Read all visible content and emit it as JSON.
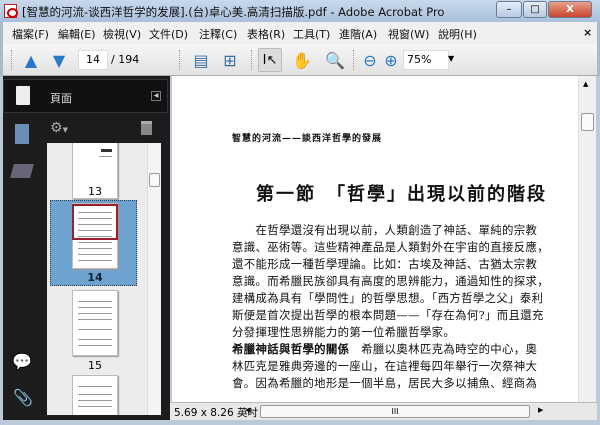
{
  "window": {
    "title": "[智慧的河流-谈西洋哲学的发展].(台)卓心美.高清扫描版.pdf - Adobe Acrobat Pro",
    "minimize": "–",
    "maximize": "□",
    "close": "X"
  },
  "menu": [
    "檔案(F)",
    "編輯(E)",
    "檢視(V)",
    "文件(D)",
    "注釋(C)",
    "表格(R)",
    "工具(T)",
    "進階(A)",
    "視窗(W)",
    "說明(H)"
  ],
  "menu_close": "×",
  "toolbar": {
    "page_current": "14",
    "page_total": "/ 194",
    "zoom": "75%"
  },
  "panel": {
    "title": "頁面",
    "thumbnails": [
      {
        "label": "13"
      },
      {
        "label": "14",
        "selected": true
      },
      {
        "label": "15"
      }
    ]
  },
  "document": {
    "running_header": "智慧的河流——談西洋哲學的發展",
    "heading": "第一節　「哲學」出現以前的階段",
    "lines": [
      "　　在哲學還沒有出現以前，人類創造了神話、單純的宗教",
      "意識、巫術等。這些精神產品是人類對外在宇宙的直接反應，",
      "還不能形成一種哲學理論。比如：古埃及神話、古猶太宗教",
      "意識。而希臘民族卻具有高度的思辨能力，通過知性的探求，",
      "建構成為具有「學問性」的哲學思想。「西方哲學之父」泰利",
      "斯便是首次提出哲學的根本問題——「存在為何?」而且還充",
      "分發揮理性思辨能力的第一位希臘哲學家。"
    ],
    "subhead": "希臘神話與哲學的關係",
    "lines2": [
      "　希臘以奧林匹克為時空的中心，奧",
      "林匹克是雅典旁邊的一座山，在這裡每四年舉行一次祭神大",
      "會。因為希臘的地形是一個半島，居民大多以捕魚、經商為"
    ]
  },
  "status": {
    "page_size": "5.69 x 8.26 英吋"
  },
  "colors": {
    "selection": "#6fa3cf",
    "panel_bg": "#1c1c1c"
  }
}
